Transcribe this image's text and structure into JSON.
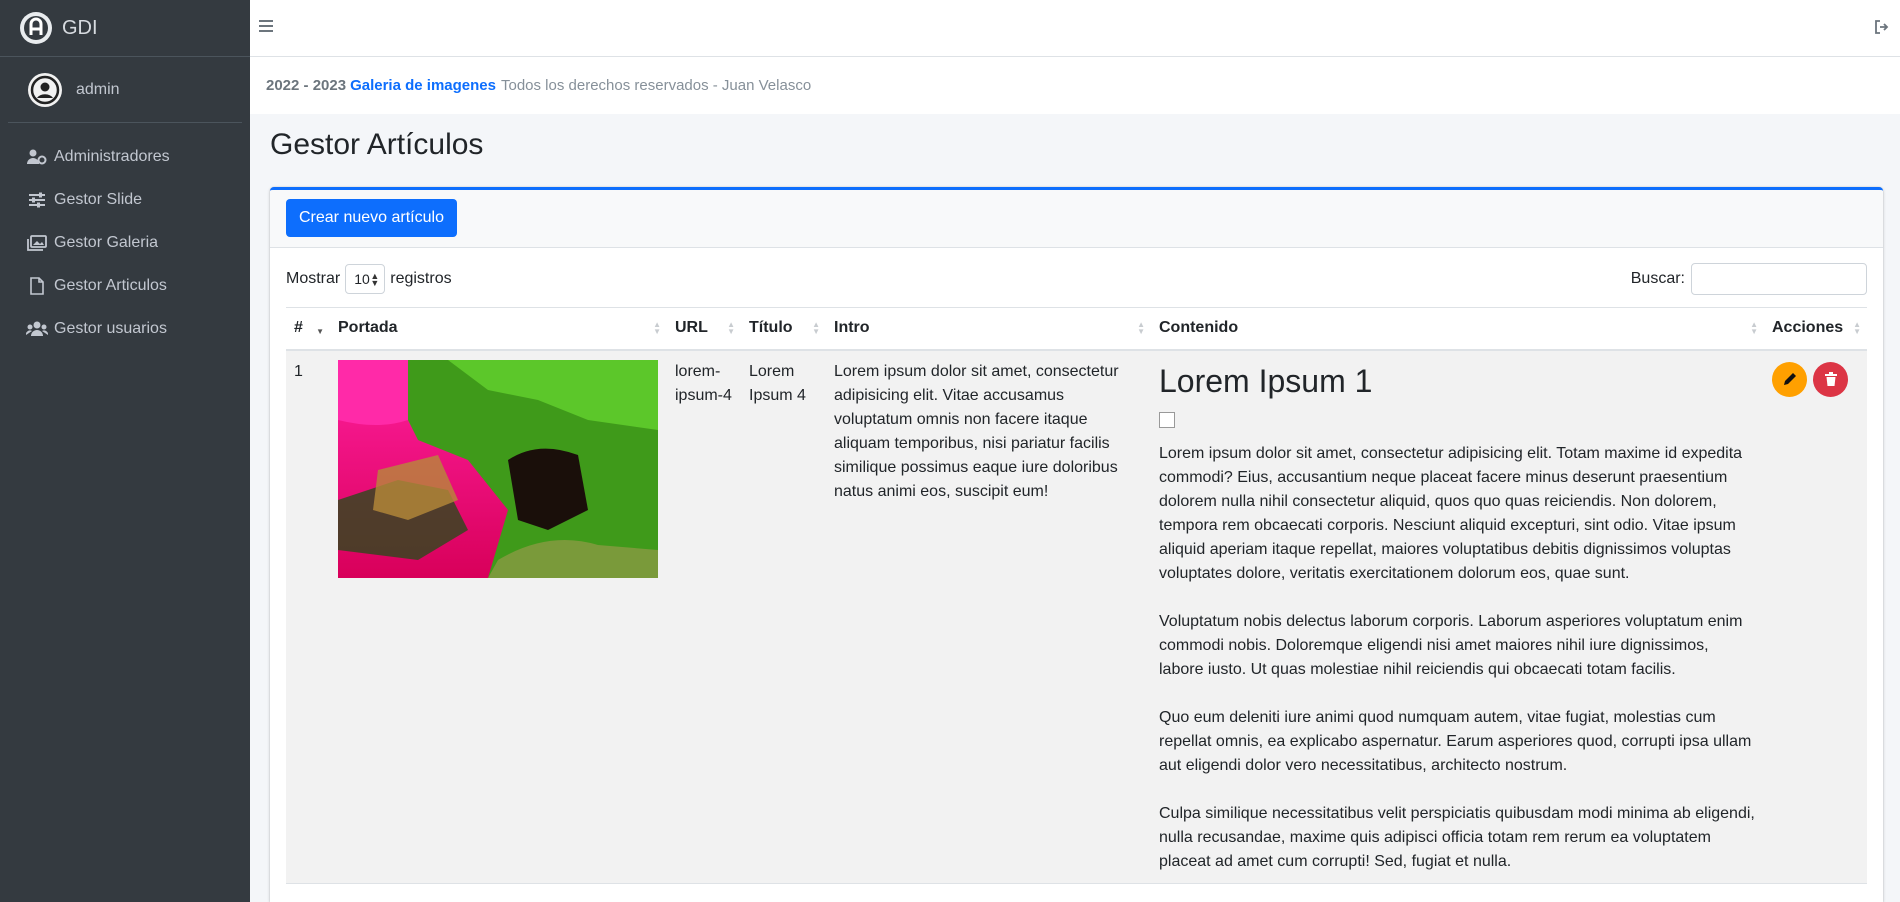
{
  "brand": {
    "name": "GDI"
  },
  "user": {
    "name": "admin"
  },
  "sidebar": {
    "items": [
      {
        "label": "Administradores",
        "icon": "users-cog-icon"
      },
      {
        "label": "Gestor Slide",
        "icon": "sliders-icon"
      },
      {
        "label": "Gestor Galeria",
        "icon": "images-icon"
      },
      {
        "label": "Gestor Articulos",
        "icon": "file-icon"
      },
      {
        "label": "Gestor usuarios",
        "icon": "users-icon"
      }
    ]
  },
  "footer": {
    "years": "2022 - 2023",
    "site_link": "Galeria de imagenes",
    "rights": "Todos los derechos reservados - Juan Velasco"
  },
  "page": {
    "title": "Gestor Artículos"
  },
  "card": {
    "new_button": "Crear nuevo artículo"
  },
  "table_controls": {
    "show_label": "Mostrar",
    "show_value": "10",
    "records_label": "registros",
    "search_label": "Buscar:"
  },
  "table": {
    "headers": [
      "#",
      "Portada",
      "URL",
      "Título",
      "Intro",
      "Contenido",
      "Acciones"
    ],
    "rows": [
      {
        "num": "1",
        "url": "lorem-ipsum-4",
        "title": "Lorem Ipsum 4",
        "intro": "Lorem ipsum dolor sit amet, consectetur adipisicing elit. Vitae accusamus voluptatum omnis non facere itaque aliquam temporibus, nisi pariatur facilis similique possimus eaque iure doloribus natus animi eos, suscipit eum!",
        "content_title": "Lorem Ipsum 1",
        "content_paragraphs": [
          "Lorem ipsum dolor sit amet, consectetur adipisicing elit. Totam maxime id expedita commodi? Eius, accusantium neque placeat facere minus deserunt praesentium dolorem nulla nihil consectetur aliquid, quos quo quas reiciendis. Non dolorem, tempora rem obcaecati corporis. Nesciunt aliquid excepturi, sint odio. Vitae ipsum aliquid aperiam itaque repellat, maiores voluptatibus debitis dignissimos voluptas voluptates dolore, veritatis exercitationem dolorum eos, quae sunt.",
          "Voluptatum nobis delectus laborum corporis. Laborum asperiores voluptatum enim commodi nobis. Doloremque eligendi nisi amet maiores nihil iure dignissimos, labore iusto. Ut quas molestiae nihil reiciendis qui obcaecati totam facilis.",
          "Quo eum deleniti iure animi quod numquam autem, vitae fugiat, molestias cum repellat omnis, ea explicabo aspernatur. Earum asperiores quod, corrupti ipsa ullam aut eligendi dolor vero necessitatibus, architecto nostrum.",
          "Culpa similique necessitatibus velit perspiciatis quibusdam modi minima ab eligendi, nulla recusandae, maxime quis adipisci officia totam rem rerum ea voluptatem placeat ad amet cum corrupti! Sed, fugiat et nulla."
        ]
      }
    ]
  },
  "colors": {
    "sidebar_bg": "#343a40",
    "primary": "#0d6efd",
    "edit": "#ffa000",
    "delete": "#dc3545"
  }
}
